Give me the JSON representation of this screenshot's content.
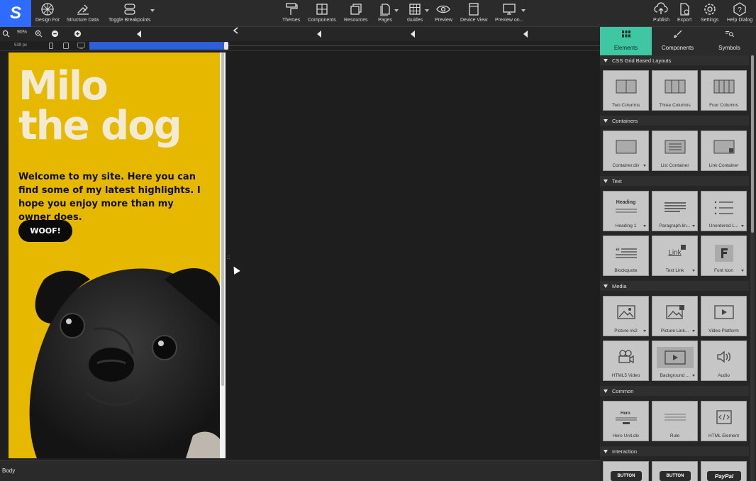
{
  "toolbar": {
    "left": [
      "Design For",
      "Structure Data",
      "Toggle Breakpoints"
    ],
    "center": [
      "Themes",
      "Components",
      "Resources",
      "Pages",
      "Guides",
      "Preview",
      "Device View",
      "Preview on..."
    ],
    "right": [
      "Publish",
      "Export",
      "Settings",
      "Help Dialog"
    ]
  },
  "subbar": {
    "zoom": "90%",
    "width_px": "539 px"
  },
  "page": {
    "heading_line1": "Milo",
    "heading_line2": "the dog",
    "intro": "Welcome to my site. Here you can find some of my latest highlights. I hope you enjoy more than my owner does.",
    "button": "WOOF!"
  },
  "status": {
    "path": "Body"
  },
  "panel": {
    "tabs": [
      "Elements",
      "Components",
      "Symbols"
    ],
    "active_tab": "Elements",
    "sections": [
      {
        "title": "CSS Grid Based Layouts",
        "tiles": [
          "Two Columns",
          "Three Columns",
          "Four Columns"
        ]
      },
      {
        "title": "Containers",
        "tiles": [
          "Container.div",
          "List Container",
          "Link Container"
        ]
      },
      {
        "title": "Text",
        "tiles": [
          "Heading 1",
          "Paragraph.lin...",
          "Unordered L...",
          "Blockquote",
          "Text Link",
          "Font Icon"
        ]
      },
      {
        "title": "Media",
        "tiles": [
          "Picture #x2",
          "Picture Link...",
          "Video Platform",
          "HTML5 Video",
          "Background ...",
          "Audio"
        ]
      },
      {
        "title": "Common",
        "tiles": [
          "Hero Unit.div",
          "Rule",
          "HTML Element"
        ]
      },
      {
        "title": "Interaction",
        "tiles": [
          "BUTTON",
          "BUTTON",
          "PayPal"
        ]
      }
    ]
  },
  "tile_texts": {
    "heading": "Heading",
    "link": "Link",
    "hero": "Hero"
  },
  "colors": {
    "accent": "#3fc7a3",
    "logo": "#2f6bff",
    "site_bg": "#e6b800"
  }
}
